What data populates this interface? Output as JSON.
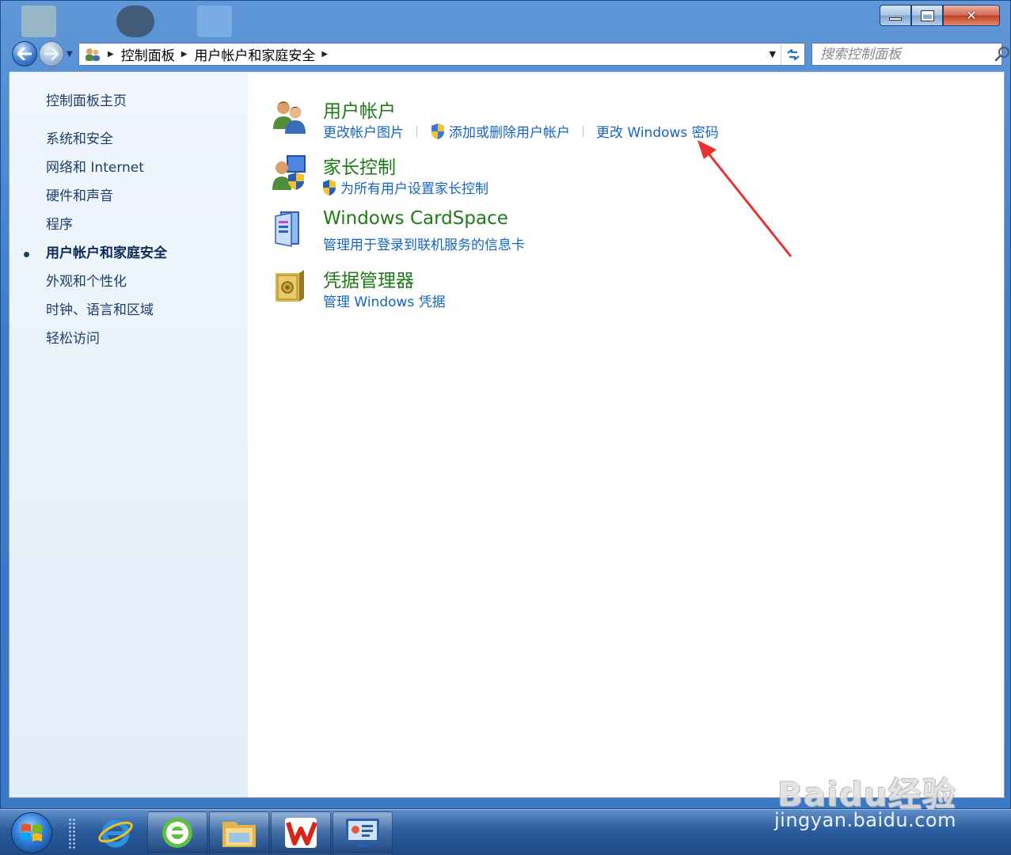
{
  "window": {
    "nav": {
      "breadcrumbs": [
        "控制面板",
        "用户帐户和家庭安全"
      ]
    },
    "search": {
      "placeholder": "搜索控制面板"
    }
  },
  "sidebar": {
    "home": "控制面板主页",
    "categories": [
      {
        "label": "系统和安全",
        "active": false
      },
      {
        "label": "网络和 Internet",
        "active": false
      },
      {
        "label": "硬件和声音",
        "active": false
      },
      {
        "label": "程序",
        "active": false
      },
      {
        "label": "用户帐户和家庭安全",
        "active": true
      },
      {
        "label": "外观和个性化",
        "active": false
      },
      {
        "label": "时钟、语言和区域",
        "active": false
      },
      {
        "label": "轻松访问",
        "active": false
      }
    ]
  },
  "main": {
    "groups": [
      {
        "title": "用户帐户",
        "icon": "user-accounts-icon",
        "links": [
          {
            "label": "更改帐户图片",
            "shield": false
          },
          {
            "label": "添加或删除用户帐户",
            "shield": true
          },
          {
            "label": "更改 Windows 密码",
            "shield": false
          }
        ]
      },
      {
        "title": "家长控制",
        "icon": "parental-controls-icon",
        "links": [
          {
            "label": "为所有用户设置家长控制",
            "shield": true
          }
        ]
      },
      {
        "title": "Windows CardSpace",
        "icon": "cardspace-icon",
        "links": [
          {
            "label": "管理用于登录到联机服务的信息卡",
            "shield": false
          }
        ]
      },
      {
        "title": "凭据管理器",
        "icon": "credential-manager-icon",
        "links": [
          {
            "label": "管理 Windows 凭据",
            "shield": false
          }
        ]
      }
    ]
  },
  "taskbar": {
    "items": [
      "start-orb-icon",
      "ie-icon",
      "ie-green-icon",
      "explorer-icon",
      "wps-icon",
      "control-panel-icon"
    ]
  },
  "watermark": {
    "logo": "Baidu经验",
    "url": "jingyan.baidu.com"
  },
  "colors": {
    "link": "#1565c0",
    "group_title": "#1e7a16",
    "annotation_arrow": "#e8322f"
  }
}
